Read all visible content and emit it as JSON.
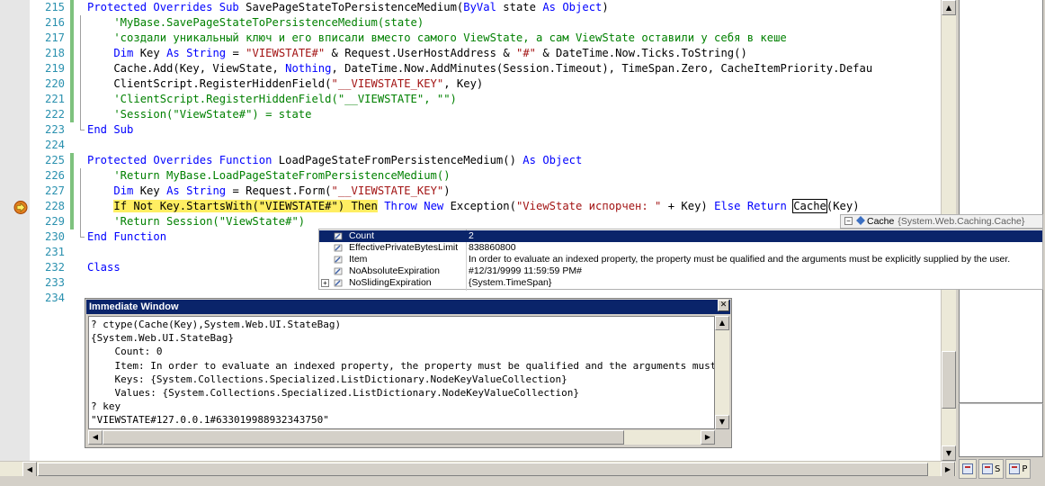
{
  "editor": {
    "lines": [
      {
        "num": "215",
        "segments": [
          {
            "t": "Protected Overrides Sub ",
            "c": "kw"
          },
          {
            "t": "SavePageStateToPersistenceMedium("
          },
          {
            "t": "ByVal",
            "c": "kw"
          },
          {
            "t": " state "
          },
          {
            "t": "As",
            "c": "kw"
          },
          {
            "t": " "
          },
          {
            "t": "Object",
            "c": "kw"
          },
          {
            "t": ")"
          }
        ]
      },
      {
        "num": "216",
        "segments": [
          {
            "t": "    'MyBase.SavePageStateToPersistenceMedium(state)",
            "c": "cm"
          }
        ]
      },
      {
        "num": "217",
        "segments": [
          {
            "t": "    'создали уникальный ключ и его вписали вместо самого ViewState, а сам ViewState оставили у себя в кеше",
            "c": "cm"
          }
        ]
      },
      {
        "num": "218",
        "segments": [
          {
            "t": "    "
          },
          {
            "t": "Dim",
            "c": "kw"
          },
          {
            "t": " Key "
          },
          {
            "t": "As",
            "c": "kw"
          },
          {
            "t": " "
          },
          {
            "t": "String",
            "c": "kw"
          },
          {
            "t": " = "
          },
          {
            "t": "\"VIEWSTATE#\"",
            "c": "str"
          },
          {
            "t": " & Request.UserHostAddress & "
          },
          {
            "t": "\"#\"",
            "c": "str"
          },
          {
            "t": " & DateTime.Now.Ticks.ToString()"
          }
        ]
      },
      {
        "num": "219",
        "segments": [
          {
            "t": "    Cache.Add(Key, ViewState, "
          },
          {
            "t": "Nothing",
            "c": "kw"
          },
          {
            "t": ", DateTime.Now.AddMinutes(Session.Timeout), TimeSpan.Zero, CacheItemPriority.Defau"
          }
        ]
      },
      {
        "num": "220",
        "segments": [
          {
            "t": "    ClientScript.RegisterHiddenField("
          },
          {
            "t": "\"__VIEWSTATE_KEY\"",
            "c": "str"
          },
          {
            "t": ", Key)"
          }
        ]
      },
      {
        "num": "221",
        "segments": [
          {
            "t": "    'ClientScript.RegisterHiddenField(\"__VIEWSTATE\", \"\")",
            "c": "cm"
          }
        ]
      },
      {
        "num": "222",
        "segments": [
          {
            "t": "    'Session(\"ViewState#\") = state",
            "c": "cm"
          }
        ]
      },
      {
        "num": "223",
        "segments": [
          {
            "t": "End Sub",
            "c": "kw"
          }
        ]
      },
      {
        "num": "224",
        "segments": []
      },
      {
        "num": "225",
        "segments": [
          {
            "t": "Protected Overrides Function ",
            "c": "kw"
          },
          {
            "t": "LoadPageStateFromPersistenceMedium() "
          },
          {
            "t": "As",
            "c": "kw"
          },
          {
            "t": " "
          },
          {
            "t": "Object",
            "c": "kw"
          }
        ]
      },
      {
        "num": "226",
        "segments": [
          {
            "t": "    'Return MyBase.LoadPageStateFromPersistenceMedium()",
            "c": "cm"
          }
        ]
      },
      {
        "num": "227",
        "segments": [
          {
            "t": "    "
          },
          {
            "t": "Dim",
            "c": "kw"
          },
          {
            "t": " Key "
          },
          {
            "t": "As",
            "c": "kw"
          },
          {
            "t": " "
          },
          {
            "t": "String",
            "c": "kw"
          },
          {
            "t": " = Request.Form("
          },
          {
            "t": "\"__VIEWSTATE_KEY\"",
            "c": "str"
          },
          {
            "t": ")"
          }
        ]
      },
      {
        "num": "228",
        "segments": [
          {
            "t": "    "
          },
          {
            "t": "If Not Key.StartsWith(\"VIEWSTATE#\") Then",
            "c": "hl"
          },
          {
            "t": " "
          },
          {
            "t": "Throw",
            "c": "kw"
          },
          {
            "t": " "
          },
          {
            "t": "New",
            "c": "kw"
          },
          {
            "t": " Exception("
          },
          {
            "t": "\"ViewState испорчен: \"",
            "c": "str"
          },
          {
            "t": " + Key) "
          },
          {
            "t": "Else",
            "c": "kw"
          },
          {
            "t": " "
          },
          {
            "t": "Return",
            "c": "kw"
          },
          {
            "t": " "
          },
          {
            "t": "Cache",
            "c": "hover"
          },
          {
            "t": "(Key)"
          }
        ]
      },
      {
        "num": "229",
        "segments": [
          {
            "t": "    'Return Session(\"ViewState#\")",
            "c": "cm"
          }
        ]
      },
      {
        "num": "230",
        "segments": [
          {
            "t": "End Function",
            "c": "kw"
          }
        ]
      },
      {
        "num": "231",
        "segments": []
      },
      {
        "num": "232",
        "segments": [
          {
            "t": "Class",
            "c": "kw"
          }
        ]
      },
      {
        "num": "233",
        "segments": []
      },
      {
        "num": "234",
        "segments": []
      }
    ]
  },
  "datatip": {
    "header_name": "Cache",
    "header_value": "{System.Web.Caching.Cache}",
    "rows": [
      {
        "name": "Count",
        "value": "2",
        "selected": true,
        "expandable": false
      },
      {
        "name": "EffectivePrivateBytesLimit",
        "value": "838860800",
        "selected": false,
        "expandable": false
      },
      {
        "name": "Item",
        "value": "In order to evaluate an indexed property, the property must be qualified and the arguments must be explicitly supplied by the user.",
        "selected": false,
        "expandable": false
      },
      {
        "name": "NoAbsoluteExpiration",
        "value": "#12/31/9999 11:59:59 PM#",
        "selected": false,
        "expandable": false
      },
      {
        "name": "NoSlidingExpiration",
        "value": "{System.TimeSpan}",
        "selected": false,
        "expandable": true
      }
    ]
  },
  "immediate": {
    "title": "Immediate Window",
    "lines": [
      "? ctype(Cache(Key),System.Web.UI.StateBag)",
      "{System.Web.UI.StateBag}",
      "    Count: 0",
      "    Item: In order to evaluate an indexed property, the property must be qualified and the arguments must be explicitly supplied by the user.",
      "    Keys: {System.Collections.Specialized.ListDictionary.NodeKeyValueCollection}",
      "    Values: {System.Collections.Specialized.ListDictionary.NodeKeyValueCollection}",
      "? key",
      "\"VIEWSTATE#127.0.0.1#633019988932343750\""
    ]
  },
  "right_panel": {
    "tabs": [
      {
        "label": "S"
      },
      {
        "label": "P"
      }
    ]
  },
  "colors": {
    "keyword": "#0000ff",
    "string": "#a31515",
    "comment": "#008000",
    "line_number": "#2b91af",
    "current_statement": "#ffee62",
    "selection": "#0a246a"
  }
}
